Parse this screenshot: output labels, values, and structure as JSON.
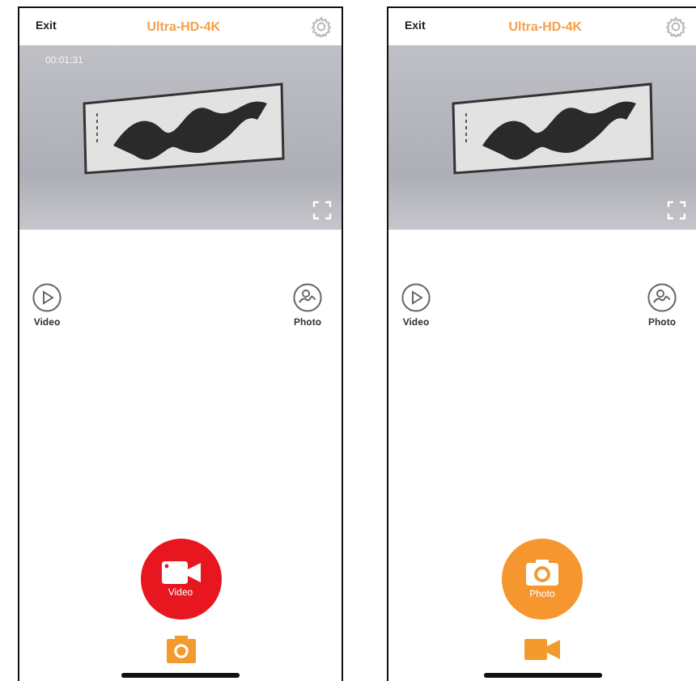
{
  "screens": [
    {
      "exit": "Exit",
      "title": "Ultra-HD-4K",
      "timer": "00:01:31",
      "shortcuts": [
        {
          "kind": "video",
          "label": "Video"
        },
        {
          "kind": "photo",
          "label": "Photo"
        }
      ],
      "shutter": {
        "kind": "video",
        "label": "Video"
      }
    },
    {
      "exit": "Exit",
      "title": "Ultra-HD-4K",
      "shortcuts": [
        {
          "kind": "video",
          "label": "Video"
        },
        {
          "kind": "photo",
          "label": "Photo"
        }
      ],
      "shutter": {
        "kind": "photo",
        "label": "Photo"
      }
    }
  ]
}
